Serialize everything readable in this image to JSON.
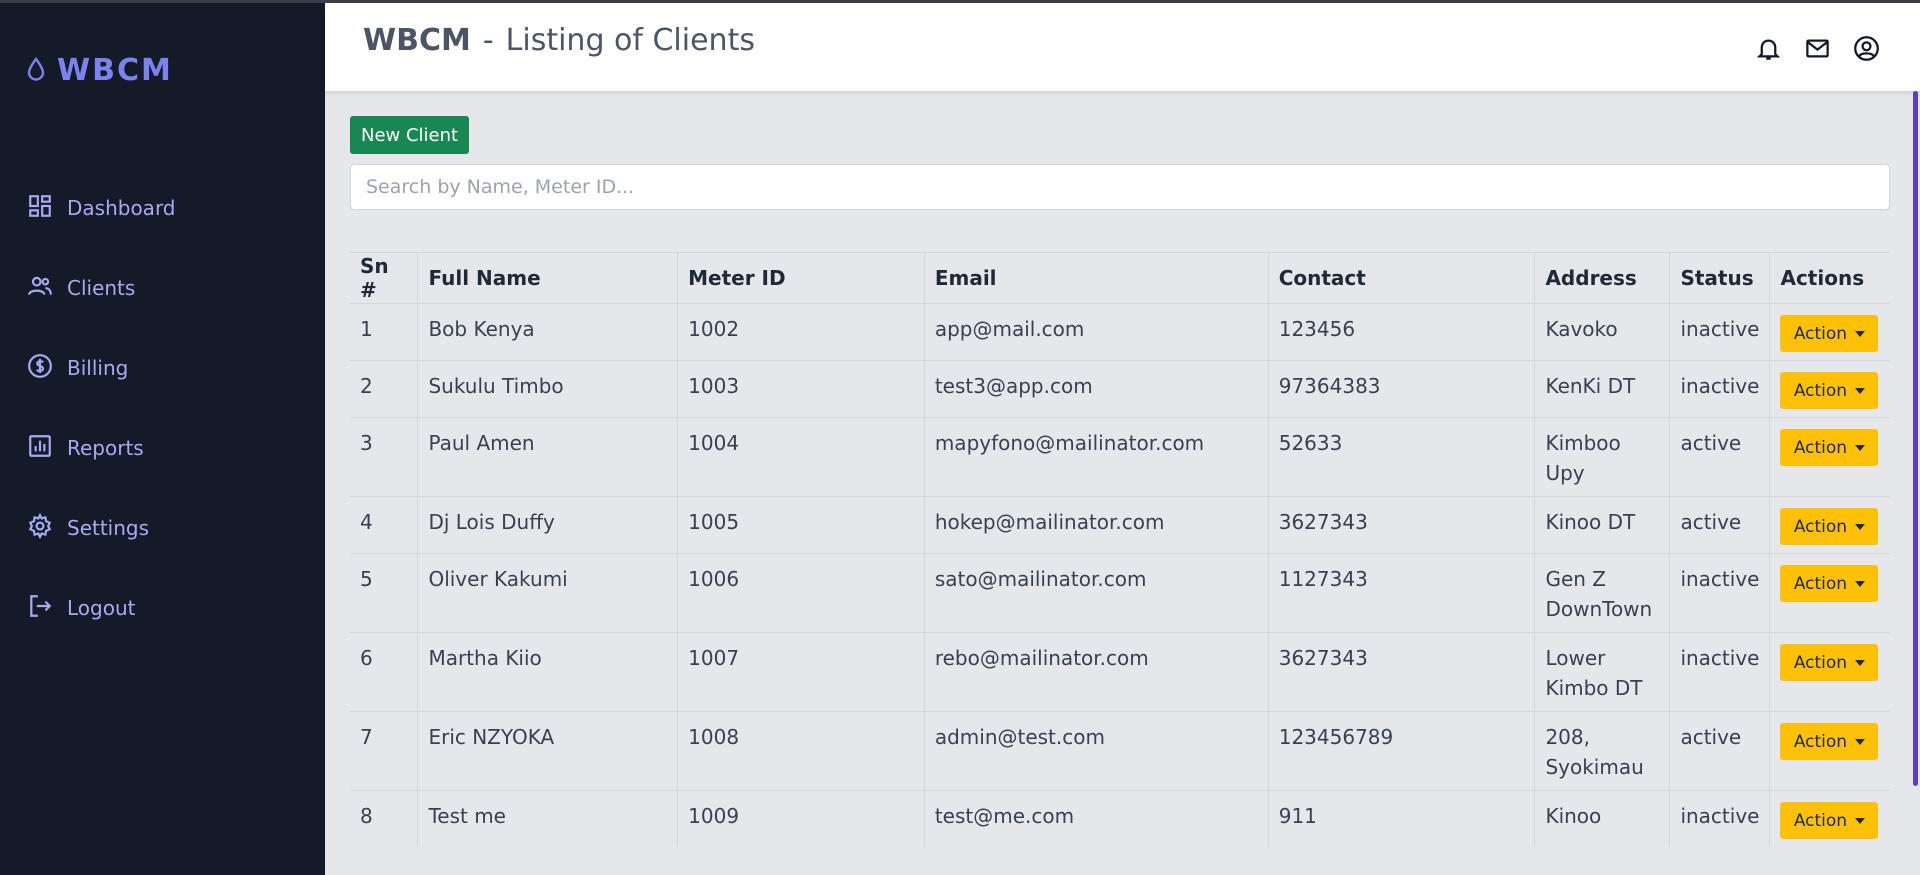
{
  "app": {
    "brand": "WBCM",
    "brand_color": "#7b83f0"
  },
  "sidebar": {
    "items": [
      {
        "label": "Dashboard",
        "icon": "dashboard-icon"
      },
      {
        "label": "Clients",
        "icon": "users-icon"
      },
      {
        "label": "Billing",
        "icon": "dollar-icon"
      },
      {
        "label": "Reports",
        "icon": "chart-icon"
      },
      {
        "label": "Settings",
        "icon": "gear-icon"
      },
      {
        "label": "Logout",
        "icon": "logout-icon"
      }
    ]
  },
  "header": {
    "brand": "WBCM",
    "separator": "-",
    "page_title": "Listing of Clients",
    "icons": [
      "bell-icon",
      "mail-icon",
      "user-circle-icon"
    ]
  },
  "toolbar": {
    "new_client_label": "New Client",
    "new_client_color": "#198754"
  },
  "search": {
    "placeholder": "Search by Name, Meter ID..."
  },
  "table": {
    "columns": [
      "Sn #",
      "Full Name",
      "Meter ID",
      "Email",
      "Contact",
      "Address",
      "Status",
      "Actions"
    ],
    "rows": [
      {
        "sn": "1",
        "name": "Bob Kenya",
        "meter": "1002",
        "email": "app@mail.com",
        "contact": "123456",
        "address": [
          "Kavoko",
          ""
        ],
        "status": "inactive",
        "action": "Action"
      },
      {
        "sn": "2",
        "name": "Sukulu Timbo",
        "meter": "1003",
        "email": "test3@app.com",
        "contact": "97364383",
        "address": [
          "KenKi DT",
          ""
        ],
        "status": "inactive",
        "action": "Action"
      },
      {
        "sn": "3",
        "name": "Paul Amen",
        "meter": "1004",
        "email": "mapyfono@mailinator.com",
        "contact": "52633",
        "address": [
          "Kimboo",
          "Upy"
        ],
        "status": "active",
        "action": "Action"
      },
      {
        "sn": "4",
        "name": "Dj Lois Duffy",
        "meter": "1005",
        "email": "hokep@mailinator.com",
        "contact": "3627343",
        "address": [
          "Kinoo DT",
          ""
        ],
        "status": "active",
        "action": "Action"
      },
      {
        "sn": "5",
        "name": "Oliver Kakumi",
        "meter": "1006",
        "email": "sato@mailinator.com",
        "contact": "1127343",
        "address": [
          "Gen Z",
          "DownTown"
        ],
        "status": "inactive",
        "action": "Action"
      },
      {
        "sn": "6",
        "name": "Martha Kiio",
        "meter": "1007",
        "email": "rebo@mailinator.com",
        "contact": "3627343",
        "address": [
          "Lower",
          "Kimbo DT"
        ],
        "status": "inactive",
        "action": "Action"
      },
      {
        "sn": "7",
        "name": "Eric NZYOKA",
        "meter": "1008",
        "email": "admin@test.com",
        "contact": "123456789",
        "address": [
          "208,",
          "Syokimau"
        ],
        "status": "active",
        "action": "Action"
      },
      {
        "sn": "8",
        "name": "Test me",
        "meter": "1009",
        "email": "test@me.com",
        "contact": "911",
        "address": [
          "Kinoo",
          ""
        ],
        "status": "inactive",
        "action": "Action"
      }
    ]
  }
}
